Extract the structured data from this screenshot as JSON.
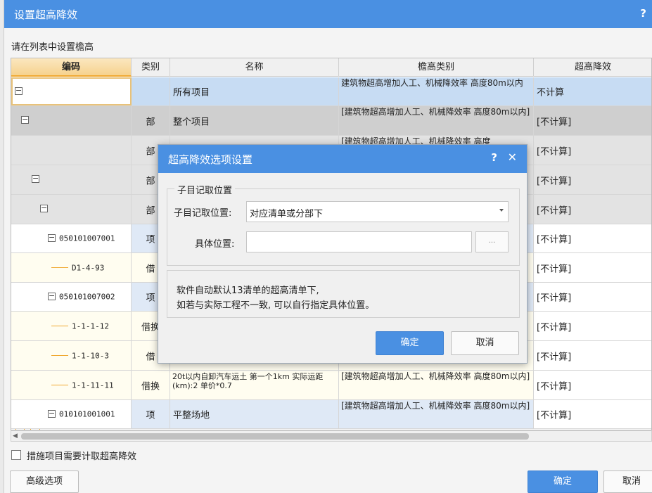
{
  "dialog": {
    "title": "设置超高降效",
    "help": "?",
    "prompt": "请在列表中设置檐高",
    "columns": [
      "编码",
      "类别",
      "名称",
      "檐高类别",
      "超高降效"
    ],
    "rows": [
      {
        "code": "",
        "type": "",
        "name": "所有项目",
        "eave": "建筑物超高增加人工、机械降效率 高度80m以内",
        "effect": "不计算"
      },
      {
        "code": "",
        "type": "部",
        "name": "整个项目",
        "eave": "[建筑物超高增加人工、机械降效率 高度80m以内]",
        "effect": "[不计算]"
      },
      {
        "code": "",
        "type": "部",
        "name": "",
        "eave": "[建筑物超高增加人工、机械降效率 高度",
        "effect": "[不计算]"
      },
      {
        "code": "",
        "type": "部",
        "name": "",
        "eave": "",
        "effect": "[不计算]"
      },
      {
        "code": "",
        "type": "部",
        "name": "",
        "eave": "",
        "effect": "[不计算]"
      },
      {
        "code": "050101007001",
        "type": "项",
        "name": "",
        "eave": "",
        "effect": "[不计算]"
      },
      {
        "code": "D1-4-93",
        "type": "借",
        "name": "",
        "eave": "",
        "effect": "[不计算]"
      },
      {
        "code": "050101007002",
        "type": "项",
        "name": "",
        "eave": "",
        "effect": "[不计算]"
      },
      {
        "code": "1-1-1-12",
        "type": "借换",
        "name": "",
        "eave": "",
        "effect": "[不计算]"
      },
      {
        "code": "1-1-10-3",
        "type": "借",
        "name": "",
        "eave": "",
        "effect": "[不计算]"
      },
      {
        "code": "1-1-11-11",
        "type": "借换",
        "name": "20t以内自卸汽车运土 第一个1km 实际运距(km):2 单价*0.7",
        "eave": "[建筑物超高增加人工、机械降效率 高度80m以内]",
        "effect": "[不计算]"
      },
      {
        "code": "010101001001",
        "type": "项",
        "name": "平整场地",
        "eave": "[建筑物超高增加人工、机械降效率 高度80m以内]",
        "effect": "[不计算]"
      }
    ],
    "checkbox_label": "措施项目需要计取超高降效",
    "advanced_label": "高级选项",
    "ok_label": "确定",
    "cancel_label": "取消"
  },
  "modal": {
    "title": "超高降效选项设置",
    "help": "?",
    "close": "✕",
    "group_label": "子目记取位置",
    "position_label": "子目记取位置:",
    "position_value": "对应清单或分部下",
    "specific_label": "具体位置:",
    "browse_label": "...",
    "note_line1": "软件自动默认13清单的超高清单下,",
    "note_line2": "如若与实际工程不一致, 可以自行指定具体位置。",
    "ok_label": "确定",
    "cancel_label": "取消"
  },
  "colors": {
    "accent": "#4a90e2",
    "selected_row": "#c7dcf3",
    "group_row": "#cfcfcf",
    "tree_line": "#f0a830",
    "code_header": "#f6d28e"
  }
}
